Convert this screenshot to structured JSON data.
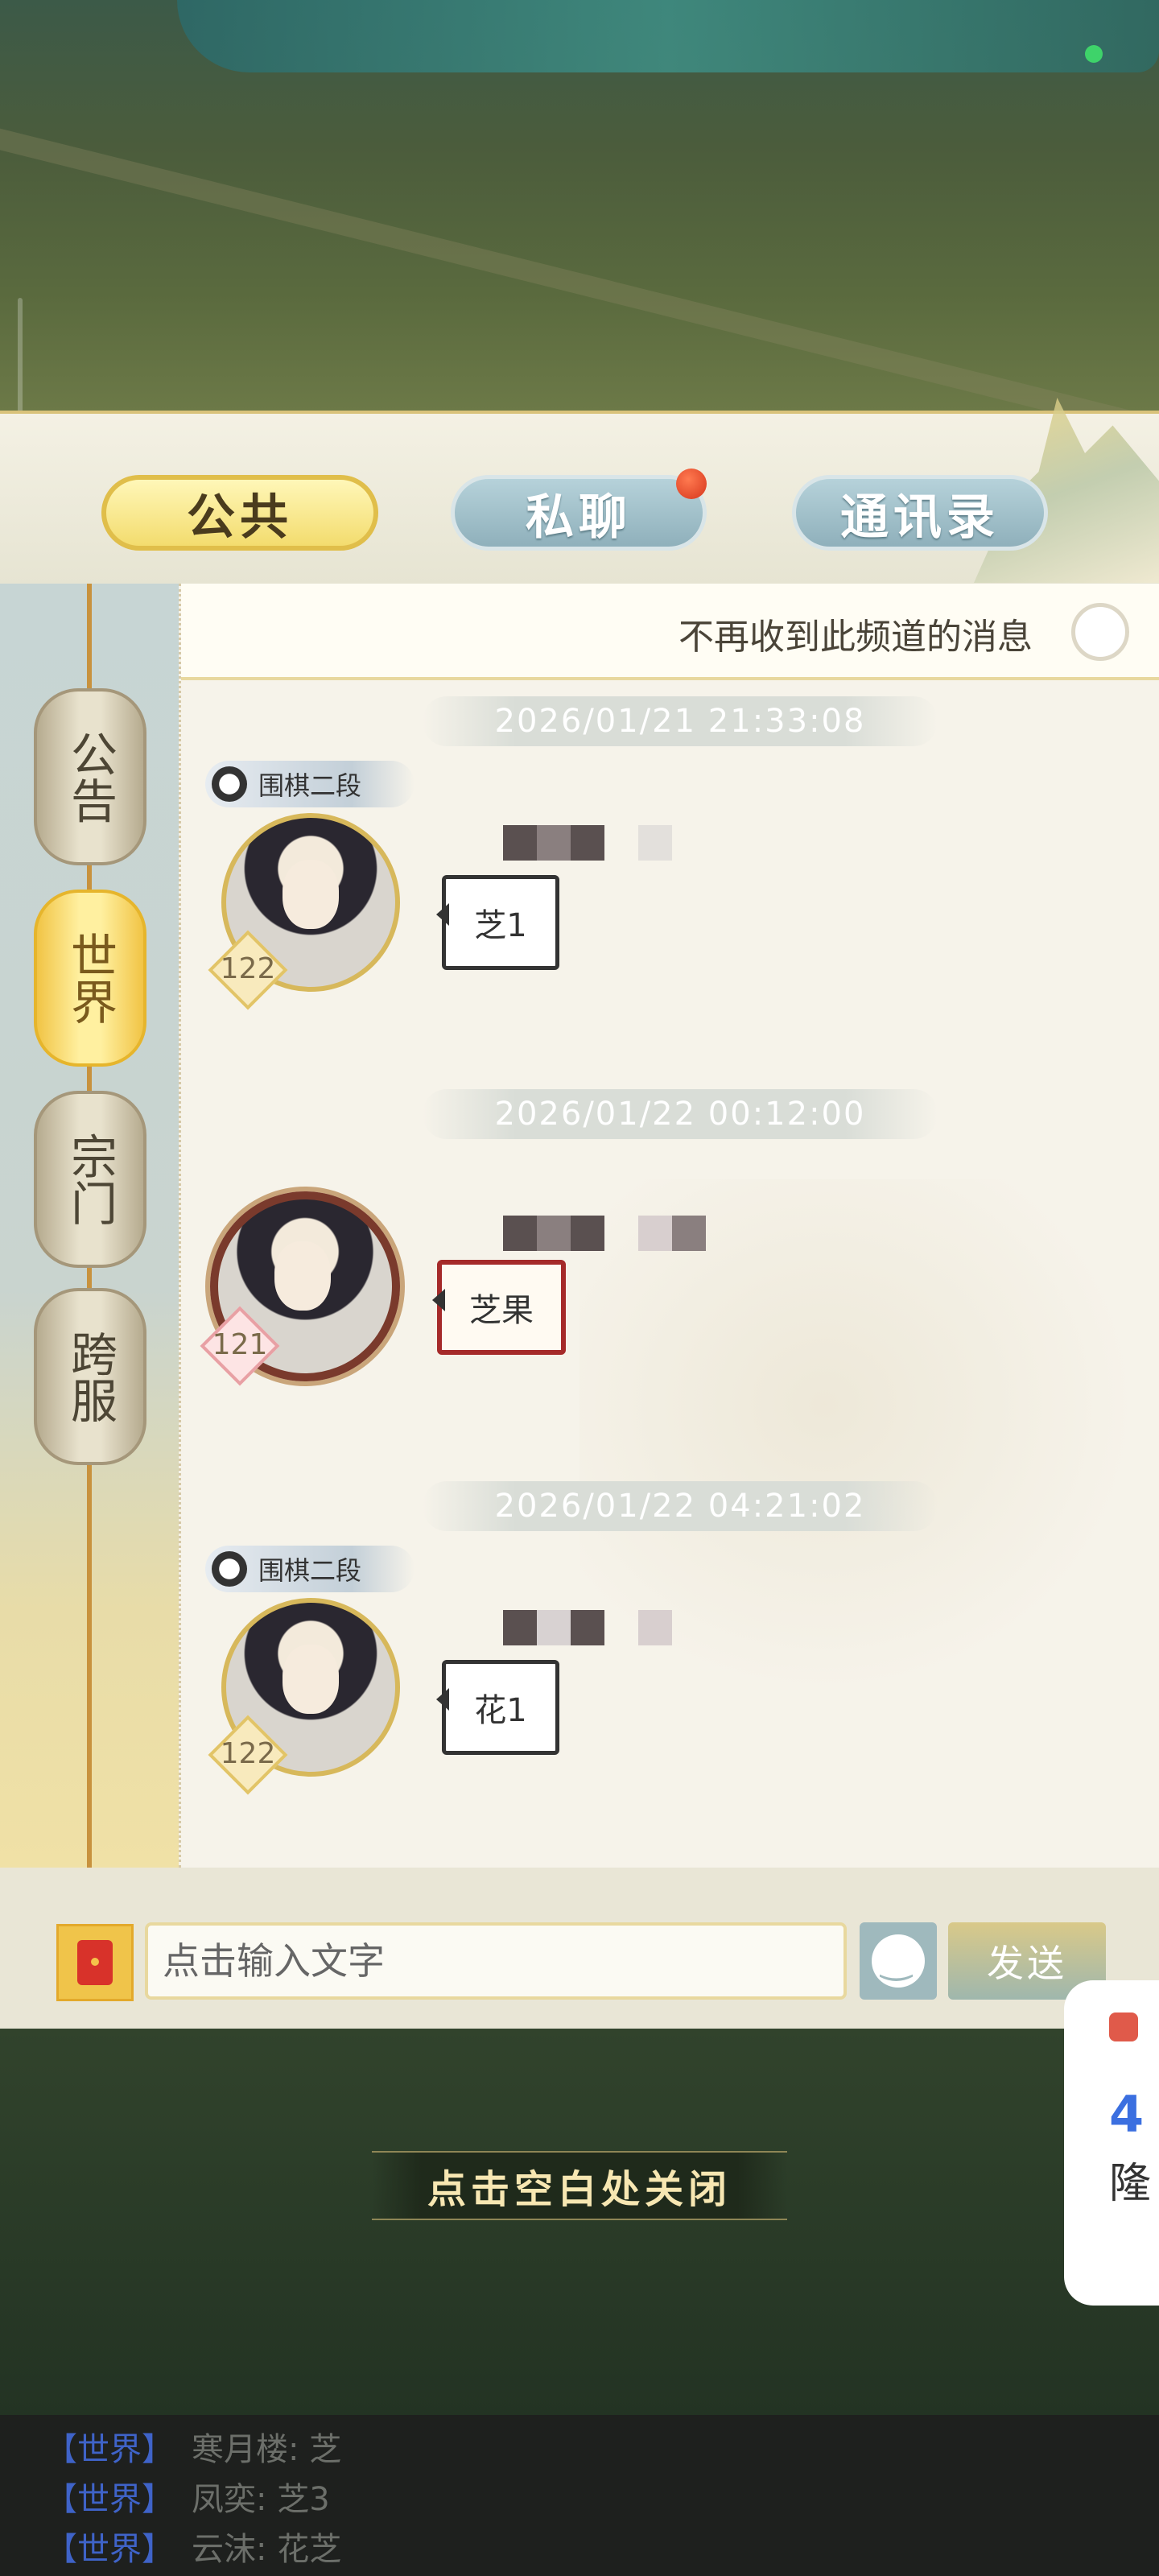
{
  "tabs": {
    "public": "公共",
    "private": "私聊",
    "contacts": "通讯录"
  },
  "side_channels": [
    {
      "label": "公告",
      "active": false
    },
    {
      "label": "世界",
      "active": true
    },
    {
      "label": "宗门",
      "active": false
    },
    {
      "label": "跨服",
      "active": false
    }
  ],
  "notice": {
    "text": "不再收到此频道的消息"
  },
  "messages": [
    {
      "timestamp": "2026/01/21  21:33:08",
      "rank": "围棋二段",
      "level": "122",
      "text": "芝1"
    },
    {
      "timestamp": "2026/01/22  00:12:00",
      "rank": "",
      "level": "121",
      "text": "芝果"
    },
    {
      "timestamp": "2026/01/22  04:21:02",
      "rank": "围棋二段",
      "level": "122",
      "text": "花1"
    }
  ],
  "input": {
    "placeholder": "点击输入文字",
    "send": "发送"
  },
  "close_hint": "点击空白处关闭",
  "popup": {
    "number": "4",
    "text": "隆"
  },
  "feed": [
    {
      "channel": "【世界】",
      "text": "寒月楼: 芝"
    },
    {
      "channel": "【世界】",
      "text": "凤奕: 芝3"
    },
    {
      "channel": "【世界】",
      "text": "云沫: 花芝"
    }
  ],
  "colors": {
    "accent_gold": "#e0be4a",
    "tab_blue": "#8fb0bb",
    "badge_red": "#d6361c",
    "channel_blue": "#3f63c8"
  }
}
